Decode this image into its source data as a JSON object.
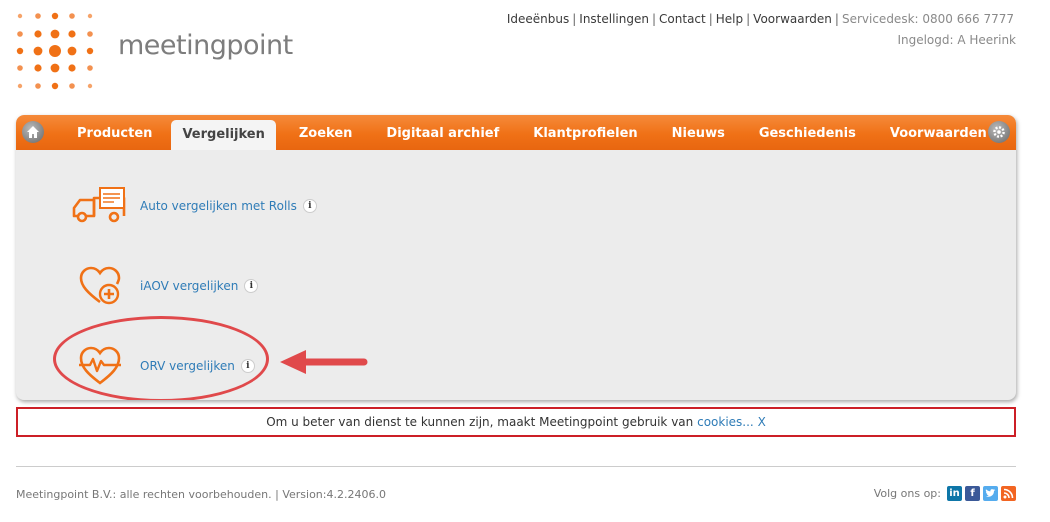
{
  "brand": {
    "name": "meetingpoint",
    "accent": "#f07116"
  },
  "header": {
    "links": [
      "Ideeënbus",
      "Instellingen",
      "Contact",
      "Help",
      "Voorwaarden"
    ],
    "servicedesk": "Servicedesk: 0800 666 7777",
    "loggedin": "Ingelogd: A Heerink"
  },
  "nav": {
    "items": [
      "Producten",
      "Vergelijken",
      "Zoeken",
      "Digitaal archief",
      "Klantprofielen",
      "Nieuws",
      "Geschiedenis",
      "Voorwaarden"
    ],
    "active_index": 1,
    "home_icon": "home-icon",
    "settings_icon": "gear-icon"
  },
  "compare_items": [
    {
      "label": "Auto vergelijken met Rolls",
      "icon": "truck-document-icon",
      "info": "i"
    },
    {
      "label": "iAOV vergelijken",
      "icon": "heart-plus-icon",
      "info": "i"
    },
    {
      "label": "ORV vergelijken",
      "icon": "heart-pulse-icon",
      "info": "i"
    }
  ],
  "annotation": {
    "color": "#e0494b"
  },
  "cookie": {
    "text": "Om u beter van dienst te kunnen zijn, maakt Meetingpoint gebruik van",
    "link": "cookies...",
    "close": "X"
  },
  "footer": {
    "copyright": "Meetingpoint B.V.: alle rechten voorbehouden. | Version:4.2.2406.0",
    "follow": "Volg ons op:",
    "social": [
      "in",
      "f",
      "t",
      "rss"
    ]
  }
}
